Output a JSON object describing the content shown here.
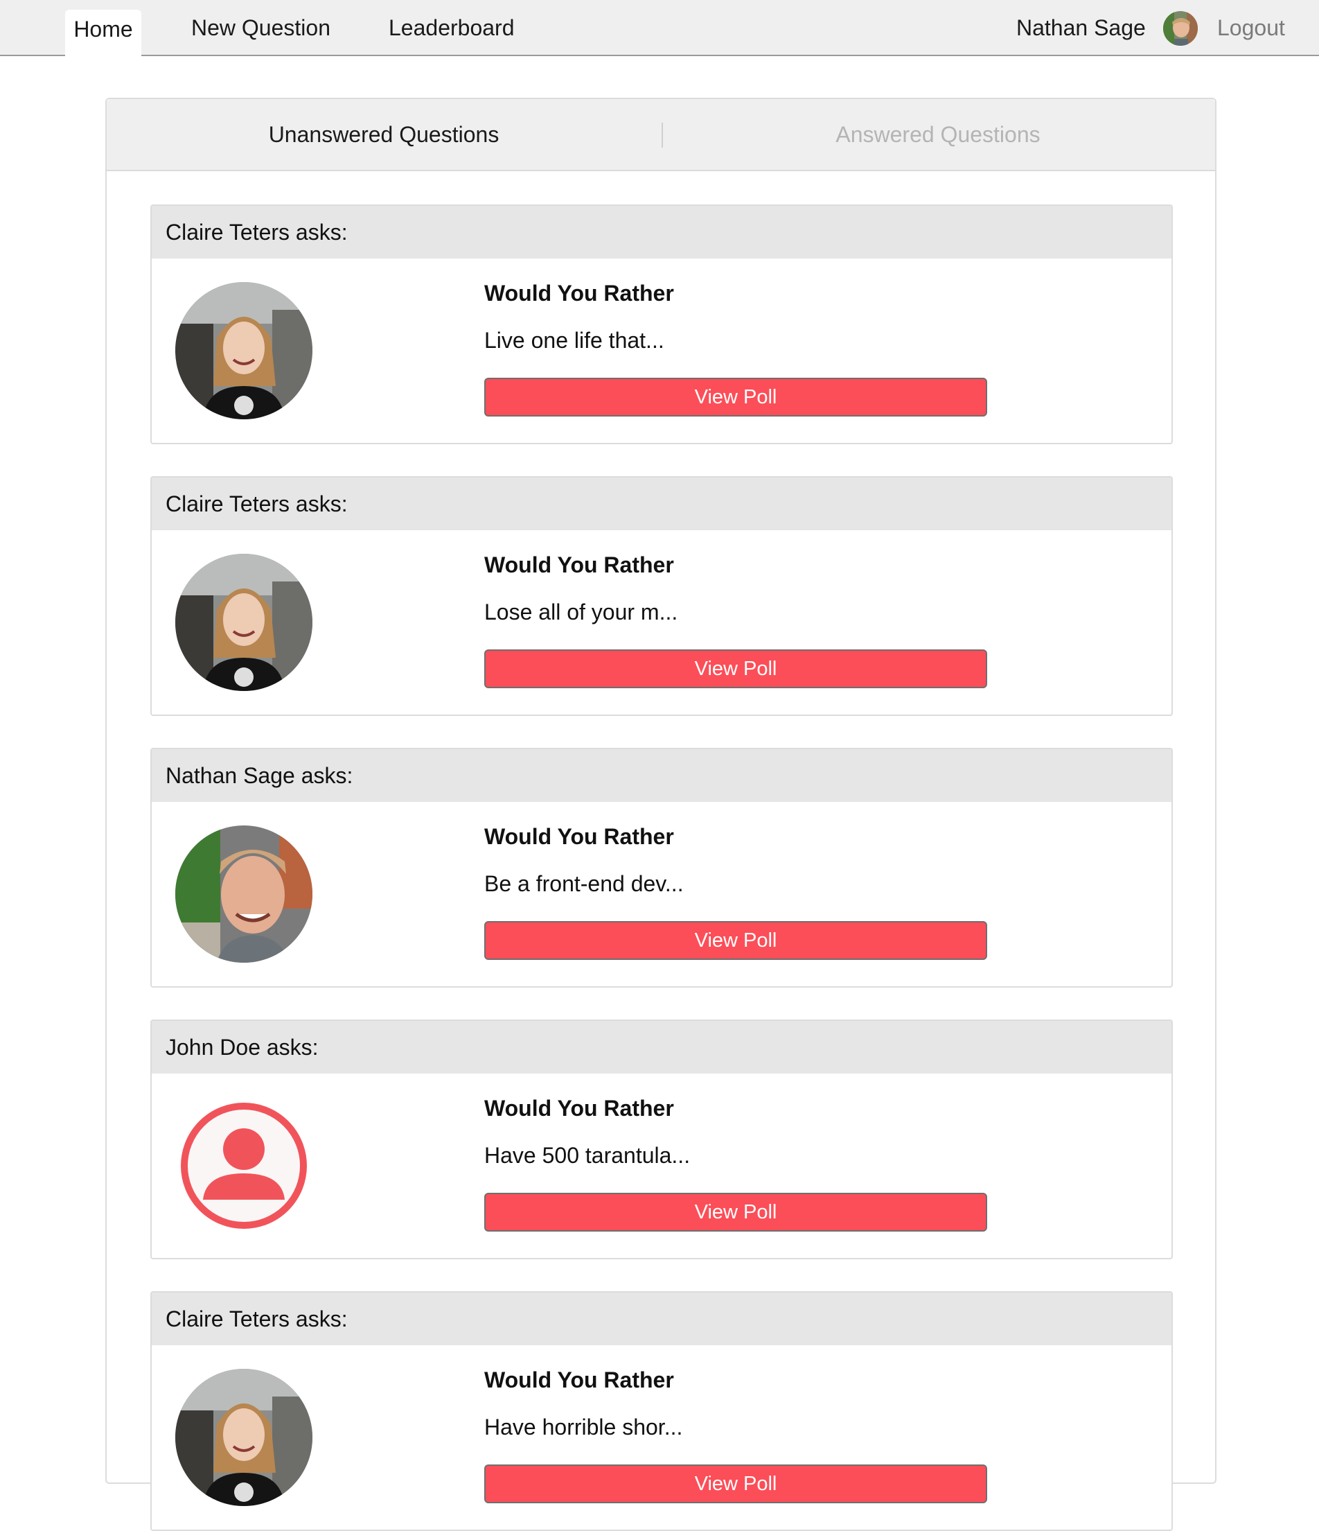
{
  "nav": {
    "tabs": [
      {
        "label": "Home",
        "active": true
      },
      {
        "label": "New Question",
        "active": false
      },
      {
        "label": "Leaderboard",
        "active": false
      }
    ],
    "user_name": "Nathan Sage",
    "logout_label": "Logout"
  },
  "question_tabs": {
    "unanswered_label": "Unanswered Questions",
    "answered_label": "Answered Questions",
    "active": "unanswered"
  },
  "questions": [
    {
      "author": "Claire Teters asks:",
      "title": "Would You Rather",
      "teaser": "Live one life that...",
      "button": "View Poll",
      "avatar": "claire-photo"
    },
    {
      "author": "Claire Teters asks:",
      "title": "Would You Rather",
      "teaser": "Lose all of your m...",
      "button": "View Poll",
      "avatar": "claire-photo"
    },
    {
      "author": "Nathan Sage asks:",
      "title": "Would You Rather",
      "teaser": "Be a front-end dev...",
      "button": "View Poll",
      "avatar": "nathan-photo"
    },
    {
      "author": "John Doe asks:",
      "title": "Would You Rather",
      "teaser": "Have 500 tarantula...",
      "button": "View Poll",
      "avatar": "default-user-icon"
    },
    {
      "author": "Claire Teters asks:",
      "title": "Would You Rather",
      "teaser": "Have horrible shor...",
      "button": "View Poll",
      "avatar": "claire-photo"
    }
  ],
  "colors": {
    "accent": "#fc4e58",
    "nav_bg": "#f0efef",
    "card_header_bg": "#e6e6e6",
    "default_avatar": "#f0545a"
  }
}
